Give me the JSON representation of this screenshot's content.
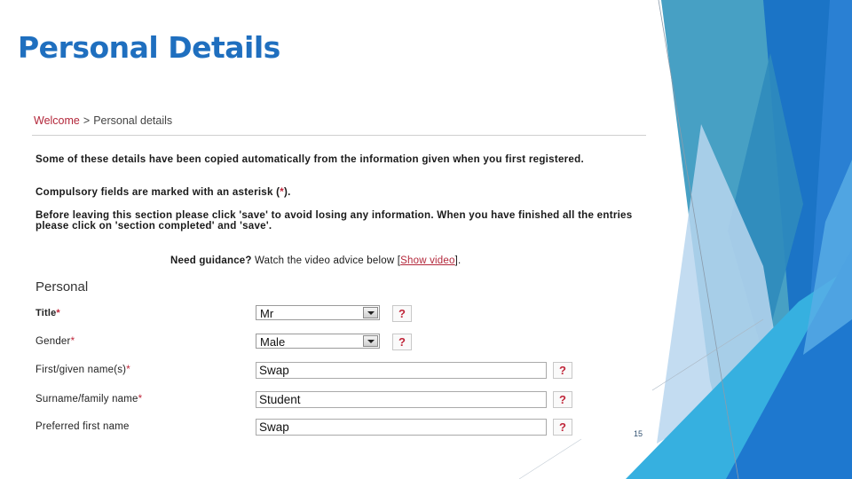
{
  "slide": {
    "title": "Personal Details",
    "page_number": "15",
    "colors": {
      "title": "#1f6fbf",
      "deco_teal": "#3d9bc1",
      "deco_blue": "#2479cf",
      "deco_deep_blue": "#1a6fc4",
      "deco_cyan": "#36b0e0",
      "deco_light": "#b9d6ee"
    }
  },
  "form": {
    "breadcrumb": {
      "link": "Welcome",
      "separator": ">",
      "current": "Personal details"
    },
    "intro": {
      "p1": "Some of these details have been copied automatically from the information given when you first registered.",
      "p2_before": "Compulsory fields are marked with an asterisk (",
      "p2_star": "*",
      "p2_after": ").",
      "p3": "Before leaving this section please click 'save' to avoid losing any information. When you have finished all the entries please click on 'section completed' and 'save'."
    },
    "guidance": {
      "need": "Need guidance?",
      "text": " Watch the video advice below ",
      "bracket_open": "[",
      "link": "Show video",
      "bracket_close": "].",
      "color_link": "#b3273a"
    },
    "section_heading": "Personal",
    "required_marker": "*",
    "help_label": "?",
    "fields": [
      {
        "label": "Title",
        "required": "*",
        "type": "select",
        "value": "Mr"
      },
      {
        "label": "Gender",
        "required": "*",
        "type": "select",
        "value": "Male"
      },
      {
        "label": "First/given name(s)",
        "required": "*",
        "type": "text",
        "value": "Swap"
      },
      {
        "label": "Surname/family name",
        "required": "*",
        "type": "text",
        "value": "Student"
      },
      {
        "label": "Preferred first name",
        "required": "",
        "type": "text",
        "value": "Swap"
      }
    ]
  }
}
